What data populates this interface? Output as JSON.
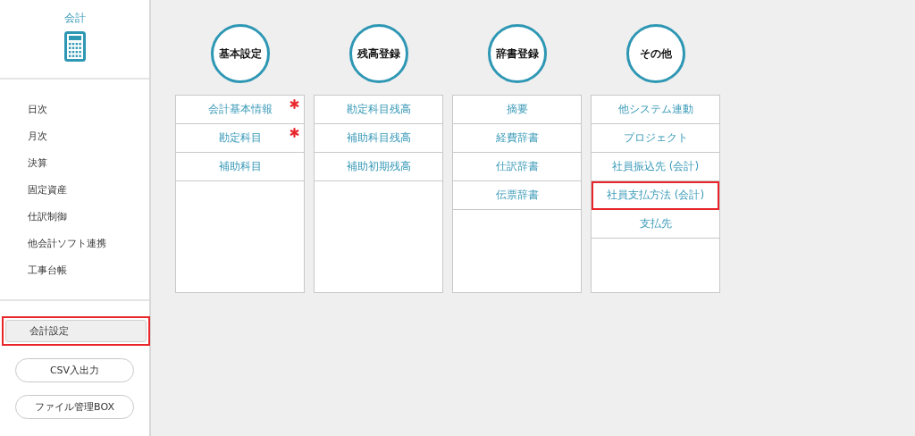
{
  "sidebar": {
    "title": "会計",
    "items": [
      {
        "label": "日次"
      },
      {
        "label": "月次"
      },
      {
        "label": "決算"
      },
      {
        "label": "固定資産"
      },
      {
        "label": "仕訳制御"
      },
      {
        "label": "他会計ソフト連携"
      },
      {
        "label": "工事台帳"
      }
    ],
    "settings": {
      "label": "会計設定",
      "selected": true,
      "highlighted": true
    },
    "buttons": [
      "CSV入出力",
      "ファイル管理BOX"
    ]
  },
  "groups": [
    {
      "title": "基本設定",
      "items": [
        {
          "label": "会計基本情報",
          "required": true,
          "highlighted": false
        },
        {
          "label": "勘定科目",
          "required": true,
          "highlighted": false
        },
        {
          "label": "補助科目",
          "required": false,
          "highlighted": false
        }
      ]
    },
    {
      "title": "残高登録",
      "items": [
        {
          "label": "勘定科目残高",
          "required": false,
          "highlighted": false
        },
        {
          "label": "補助科目残高",
          "required": false,
          "highlighted": false
        },
        {
          "label": "補助初期残高",
          "required": false,
          "highlighted": false
        }
      ]
    },
    {
      "title": "辞書登録",
      "items": [
        {
          "label": "摘要",
          "required": false,
          "highlighted": false
        },
        {
          "label": "経費辞書",
          "required": false,
          "highlighted": false
        },
        {
          "label": "仕訳辞書",
          "required": false,
          "highlighted": false
        },
        {
          "label": "伝票辞書",
          "required": false,
          "highlighted": false
        }
      ]
    },
    {
      "title": "その他",
      "items": [
        {
          "label": "他システム連動",
          "required": false,
          "highlighted": false
        },
        {
          "label": "プロジェクト",
          "required": false,
          "highlighted": false
        },
        {
          "label": "社員振込先 (会計)",
          "required": false,
          "highlighted": false
        },
        {
          "label": "社員支払方法 (会計)",
          "required": false,
          "highlighted": true
        },
        {
          "label": "支払先",
          "required": false,
          "highlighted": false
        }
      ]
    }
  ]
}
